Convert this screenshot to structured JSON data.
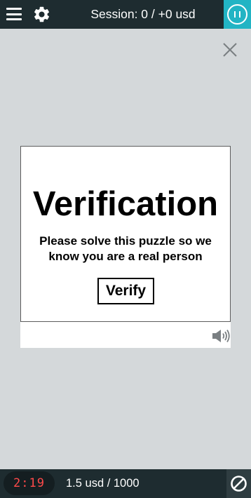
{
  "header": {
    "session_text": "Session: 0 / +0 usd",
    "menu_icon": "hamburger-menu-icon",
    "settings_icon": "gear-icon",
    "pause_icon": "pause-icon"
  },
  "captcha": {
    "title": "Verification",
    "message": "Please solve this puzzle so we know you are a real person",
    "verify_label": "Verify",
    "close_icon": "close-icon",
    "audio_icon": "speaker-icon"
  },
  "footer": {
    "timer": "2:19",
    "earnings": "1.5 usd / 1000",
    "block_icon": "block-icon"
  },
  "colors": {
    "bar_background": "#1e2c30",
    "accent": "#22b4c4",
    "timer_text": "#ff4a4a",
    "page_background": "#d4d8da"
  }
}
